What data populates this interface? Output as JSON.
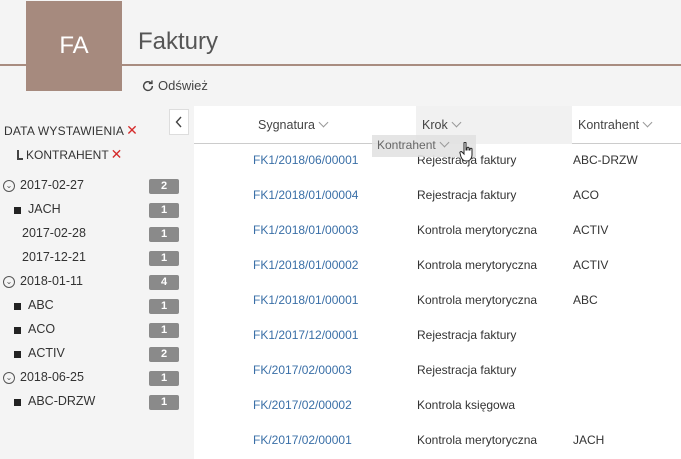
{
  "header": {
    "logo": "FA",
    "title": "Faktury",
    "refresh_label": "Odśwież"
  },
  "grouping": {
    "level1": "DATA WYSTAWIENIA",
    "level2": "KONTRAHENT"
  },
  "tree": [
    {
      "label": "2017-02-27",
      "count": "2",
      "type": "expanded"
    },
    {
      "label": "JACH",
      "count": "1",
      "type": "leaf"
    },
    {
      "label": "2017-02-28",
      "count": "1",
      "type": "plain"
    },
    {
      "label": "2017-12-21",
      "count": "1",
      "type": "plain"
    },
    {
      "label": "2018-01-11",
      "count": "4",
      "type": "expanded"
    },
    {
      "label": "ABC",
      "count": "1",
      "type": "leaf"
    },
    {
      "label": "ACO",
      "count": "1",
      "type": "leaf"
    },
    {
      "label": "ACTIV",
      "count": "2",
      "type": "leaf"
    },
    {
      "label": "2018-06-25",
      "count": "1",
      "type": "expanded"
    },
    {
      "label": "ABC-DRZW",
      "count": "1",
      "type": "leaf"
    }
  ],
  "table": {
    "columns": [
      "Sygnatura",
      "Krok",
      "Kontrahent"
    ],
    "rows": [
      [
        "FK1/2018/06/00001",
        "Rejestracja faktury",
        "ABC-DRZW"
      ],
      [
        "FK1/2018/01/00004",
        "Rejestracja faktury",
        "ACO"
      ],
      [
        "FK1/2018/01/00003",
        "Kontrola merytoryczna",
        "ACTIV"
      ],
      [
        "FK1/2018/01/00002",
        "Kontrola merytoryczna",
        "ACTIV"
      ],
      [
        "FK1/2018/01/00001",
        "Kontrola merytoryczna",
        "ABC"
      ],
      [
        "FK1/2017/12/00001",
        "Rejestracja faktury",
        ""
      ],
      [
        "FK/2017/02/00003",
        "Rejestracja faktury",
        ""
      ],
      [
        "FK/2017/02/00002",
        "Kontrola księgowa",
        ""
      ],
      [
        "FK/2017/02/00001",
        "Kontrola merytoryczna",
        "JACH"
      ]
    ]
  },
  "drag_ghost": "Kontrahent",
  "colors": {
    "accent": "#a68a7e",
    "link": "#3a6fa7",
    "remove": "#d52b2b",
    "badge": "#8a8a8a"
  },
  "icons": [
    "refresh-icon",
    "collapse-left-icon",
    "remove-icon",
    "expand-circle-icon",
    "bullet-square-icon",
    "hand-cursor-icon"
  ]
}
